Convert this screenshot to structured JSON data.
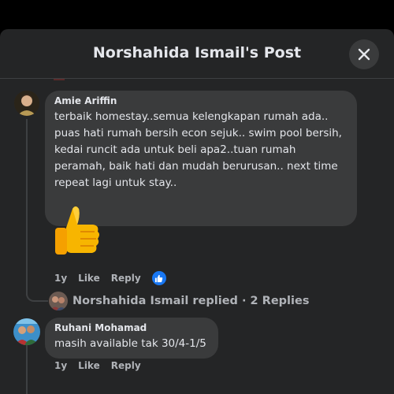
{
  "header": {
    "title": "Norshahida Ismail's Post"
  },
  "comments": [
    {
      "author": "Amie Ariffin",
      "text": "terbaik homestay..semua kelengkapan rumah ada..\npuas hati rumah bersih econ sejuk.. swim pool bersih,\nkedai runcit ada untuk beli apa2..tuan rumah\nperamah, baik hati dan mudah berurusan.. next time\nrepeat lagi untuk stay..",
      "sticker": "thumbs-up",
      "time": "1y",
      "like_label": "Like",
      "reply_label": "Reply",
      "reaction": "like"
    },
    {
      "author": "Ruhani Mohamad",
      "text": "masih available tak 30/4-1/5",
      "time": "1y",
      "like_label": "Like",
      "reply_label": "Reply"
    }
  ],
  "replies_summary": {
    "text": "Norshahida Ismail replied · 2 Replies"
  },
  "colors": {
    "modal_bg": "#242526",
    "bubble_bg": "#3a3b3c",
    "text_primary": "#e4e6eb",
    "text_secondary": "#b0b3b8",
    "like_blue": "#1877f2"
  }
}
